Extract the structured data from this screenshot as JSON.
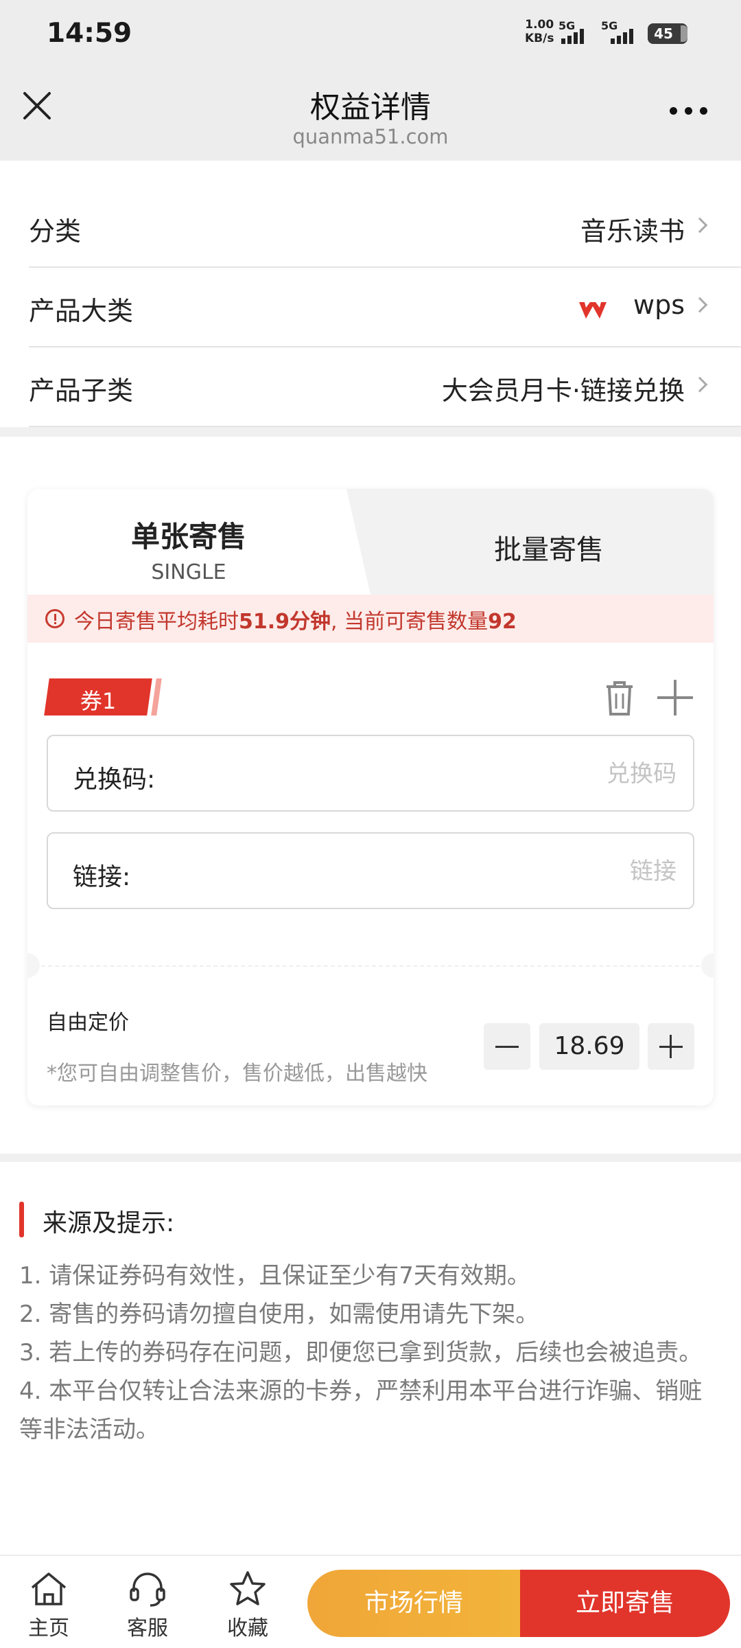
{
  "status_bar": {
    "time": "14:59",
    "net_speed_value": "1.00",
    "net_speed_unit": "KB/s",
    "signal_1_label": "5G",
    "signal_2_label": "5G",
    "battery_level": "45"
  },
  "header": {
    "title": "权益详情",
    "subtitle": "quanma51.com"
  },
  "info_rows": [
    {
      "label": "分类",
      "value": "音乐读书"
    },
    {
      "label": "产品大类",
      "value": "wps"
    },
    {
      "label": "产品子类",
      "value": "大会员月卡·链接兑换"
    }
  ],
  "tabs": {
    "single_title": "单张寄售",
    "single_subtitle": "SINGLE",
    "batch_title": "批量寄售"
  },
  "notice": {
    "prefix": "今日寄售平均耗时",
    "minutes": "51.9分钟",
    "middle": ", 当前可寄售数量",
    "count": "92"
  },
  "coupon": {
    "tag": "券1",
    "code_label": "兑换码:",
    "code_placeholder": "兑换码",
    "link_label": "链接:",
    "link_placeholder": "链接"
  },
  "pricing": {
    "label": "自由定价",
    "hint": "*您可自由调整售价，售价越低，出售越快",
    "price": "18.69"
  },
  "tips": {
    "title": "来源及提示:",
    "items": [
      "1. 请保证券码有效性，且保证至少有7天有效期。",
      "2. 寄售的券码请勿擅自使用，如需使用请先下架。",
      "3. 若上传的券码存在问题，即便您已拿到货款，后续也会被追责。",
      "4. 本平台仅转让合法来源的卡券，严禁利用本平台进行诈骗、销赃等非法活动。"
    ]
  },
  "bottom_nav": {
    "home": "主页",
    "service": "客服",
    "favorite": "收藏",
    "market": "市场行情",
    "sell_now": "立即寄售"
  },
  "colors": {
    "accent_red": "#e1352b",
    "accent_orange": "#f0a638",
    "wps_logo": "#e1352b"
  },
  "icons": [
    "close-icon",
    "more-icon",
    "chevron-right-icon",
    "wps-logo",
    "info-icon",
    "trash-icon",
    "plus-icon",
    "minus-icon",
    "home-icon",
    "headset-icon",
    "star-icon"
  ]
}
